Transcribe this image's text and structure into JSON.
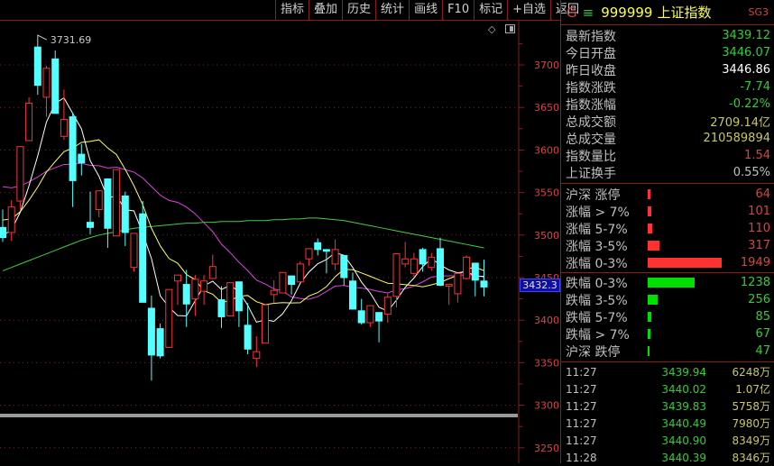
{
  "toolbar": [
    "指标",
    "叠加",
    "历史",
    "统计",
    "画线",
    "F10",
    "标记",
    "+自选",
    "返回"
  ],
  "header": {
    "g": "G",
    "menu": "≡",
    "code": "999999",
    "name": "上证指数",
    "sg": "SG3"
  },
  "stats": [
    {
      "label": "最新指数",
      "value": "3439.12",
      "color": "#30d030"
    },
    {
      "label": "今日开盘",
      "value": "3446.07",
      "color": "#30d030"
    },
    {
      "label": "昨日收盘",
      "value": "3446.86",
      "color": "#ffffff"
    },
    {
      "label": "指数涨跌",
      "value": "-7.74",
      "color": "#30d030"
    },
    {
      "label": "指数涨幅",
      "value": "-0.22%",
      "color": "#30d030"
    },
    {
      "label": "总成交额",
      "value": "2709.14亿",
      "color": "#c8c860"
    },
    {
      "label": "总成交量",
      "value": "210589894",
      "color": "#c8c860"
    },
    {
      "label": "指数量比",
      "value": "1.54",
      "color": "#e04040"
    },
    {
      "label": "上证换手",
      "value": "0.55%",
      "color": "#c0c0c0"
    }
  ],
  "up": [
    {
      "label": "沪深 涨停",
      "value": 64
    },
    {
      "label": "涨幅 > 7%",
      "value": 101
    },
    {
      "label": "涨幅 5-7%",
      "value": 110
    },
    {
      "label": "涨幅 3-5%",
      "value": 317
    },
    {
      "label": "涨幅 0-3%",
      "value": 1949
    }
  ],
  "down": [
    {
      "label": "跌幅 0-3%",
      "value": 1238
    },
    {
      "label": "跌幅 3-5%",
      "value": 256
    },
    {
      "label": "跌幅 5-7%",
      "value": 85
    },
    {
      "label": "跌幅 > 7%",
      "value": 67
    },
    {
      "label": "沪深 跌停",
      "value": 47
    }
  ],
  "ticks": [
    [
      "11:27",
      "3439.94",
      "6248万"
    ],
    [
      "11:27",
      "3440.02",
      "1.07亿"
    ],
    [
      "11:27",
      "3439.83",
      "5758万"
    ],
    [
      "11:27",
      "3440.49",
      "7980万"
    ],
    [
      "11:27",
      "3440.90",
      "8349万"
    ],
    [
      "11:28",
      "3440.39",
      "8346万"
    ]
  ],
  "colors": {
    "up": "#ff3232",
    "down": "#54ffff",
    "ma5": "#ffffff",
    "ma10": "#ffff60",
    "ma20": "#e040e0",
    "ma60": "#40d040",
    "grid": "#8a1c1c"
  },
  "chart_data": {
    "type": "candlestick",
    "ylim": [
      3230,
      3760
    ],
    "yticks": [
      3250,
      3300,
      3350,
      3400,
      3450,
      3500,
      3550,
      3600,
      3650,
      3700
    ],
    "max_label": "3731.69",
    "current_price": "3432.3",
    "ohlc": [
      [
        3509,
        3530,
        3492,
        3497
      ],
      [
        3503,
        3541,
        3493,
        3533
      ],
      [
        3540,
        3604,
        3530,
        3604
      ],
      [
        3611,
        3662,
        3611,
        3655
      ],
      [
        3721,
        3731.69,
        3665,
        3676
      ],
      [
        3662,
        3699,
        3639,
        3696
      ],
      [
        3707,
        3717,
        3643,
        3643
      ],
      [
        3616,
        3671,
        3612,
        3636
      ],
      [
        3639,
        3644,
        3533,
        3564
      ],
      [
        3595,
        3607,
        3570,
        3585
      ],
      [
        3515,
        3551,
        3501,
        3509
      ],
      [
        3530,
        3552,
        3521,
        3552
      ],
      [
        3566,
        3566,
        3485,
        3508
      ],
      [
        3499,
        3577,
        3499,
        3577
      ],
      [
        3546,
        3551,
        3487,
        3503
      ],
      [
        3462,
        3502,
        3457,
        3502
      ],
      [
        3525,
        3540,
        3421,
        3421
      ],
      [
        3414,
        3429,
        3329,
        3359
      ],
      [
        3390,
        3396,
        3355,
        3358
      ],
      [
        3368,
        3436,
        3368,
        3436
      ],
      [
        3446,
        3453,
        3418,
        3453
      ],
      [
        3442,
        3459,
        3392,
        3419
      ],
      [
        3425,
        3453,
        3405,
        3448
      ],
      [
        3434,
        3453,
        3418,
        3446
      ],
      [
        3449,
        3477,
        3449,
        3463
      ],
      [
        3424,
        3440,
        3391,
        3404
      ],
      [
        3405,
        3444,
        3405,
        3444
      ],
      [
        3445,
        3445,
        3392,
        3411
      ],
      [
        3394,
        3420,
        3360,
        3366
      ],
      [
        3355,
        3381,
        3345,
        3363
      ],
      [
        3373,
        3418,
        3373,
        3418
      ],
      [
        3430,
        3447,
        3420,
        3435
      ],
      [
        3432,
        3456,
        3432,
        3456
      ],
      [
        3452,
        3452,
        3430,
        3442
      ],
      [
        3445,
        3469,
        3445,
        3466
      ],
      [
        3472,
        3484,
        3464,
        3484
      ],
      [
        3491,
        3496,
        3476,
        3483
      ],
      [
        3483,
        3483,
        3455,
        3481
      ],
      [
        3466,
        3495,
        3459,
        3483
      ],
      [
        3476,
        3476,
        3441,
        3450
      ],
      [
        3446,
        3456,
        3426,
        3413
      ],
      [
        3411,
        3425,
        3395,
        3397
      ],
      [
        3397,
        3417,
        3392,
        3417
      ],
      [
        3409,
        3409,
        3374,
        3399
      ],
      [
        3407,
        3432,
        3397,
        3427
      ],
      [
        3428,
        3478,
        3415,
        3478
      ],
      [
        3466,
        3492,
        3462,
        3472
      ],
      [
        3455,
        3479,
        3451,
        3472
      ],
      [
        3483,
        3485,
        3457,
        3466
      ],
      [
        3462,
        3479,
        3458,
        3474
      ],
      [
        3484,
        3497,
        3440,
        3441
      ],
      [
        3440,
        3442,
        3418,
        3442
      ],
      [
        3431,
        3455,
        3421,
        3455
      ],
      [
        3449,
        3476,
        3448,
        3474
      ],
      [
        3467,
        3467,
        3428,
        3447
      ],
      [
        3446,
        3471,
        3428,
        3439
      ]
    ],
    "ma20_seed": 3560,
    "ma60": [
      3458,
      3462,
      3466,
      3470,
      3474,
      3478,
      3482,
      3486,
      3490,
      3494,
      3497,
      3500,
      3502,
      3504,
      3506,
      3508,
      3509,
      3510,
      3511,
      3512,
      3513,
      3514,
      3514,
      3515,
      3515,
      3516,
      3516,
      3516,
      3517,
      3517,
      3517,
      3518,
      3518,
      3519,
      3519,
      3520,
      3520,
      3519,
      3518,
      3517,
      3515,
      3513,
      3511,
      3509,
      3507,
      3505,
      3503,
      3501,
      3499,
      3497,
      3495,
      3493,
      3491,
      3489,
      3487,
      3485
    ]
  }
}
